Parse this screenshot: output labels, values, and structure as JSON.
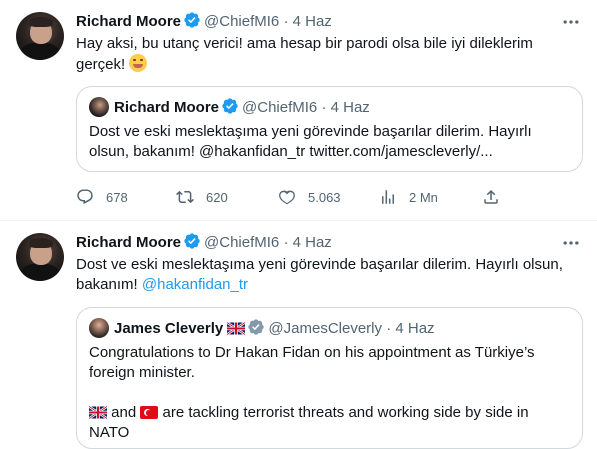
{
  "tweet1": {
    "author_name": "Richard Moore",
    "author_handle": "@ChiefMI6",
    "separator": "·",
    "timestamp": "4 Haz",
    "text": "Hay aksi, bu utanç verici! ama hesap bir parodi olsa bile iyi dileklerim",
    "text_line2": "gerçek!",
    "emoji": "smiling-face-emoji",
    "quoted": {
      "author_name": "Richard Moore",
      "author_handle": "@ChiefMI6",
      "separator": "·",
      "timestamp": "4 Haz",
      "text_line1": "Dost ve eski meslektaşıma yeni görevinde başarılar dilerim.  Hayırlı",
      "text_line2": "olsun, bakanım! @hakanfidan_tr twitter.com/jamescleverly/..."
    },
    "actions": {
      "replies": "678",
      "retweets": "620",
      "likes": "5.063",
      "views": "2 Mn"
    }
  },
  "tweet2": {
    "author_name": "Richard Moore",
    "author_handle": "@ChiefMI6",
    "separator": "·",
    "timestamp": "4 Haz",
    "text_line1": "Dost ve eski meslektaşıma yeni görevinde başarılar dilerim.  Hayırlı olsun,",
    "text_line2_prefix": "bakanım! ",
    "mention": "@hakanfidan_tr",
    "quoted": {
      "author_name": "James Cleverly",
      "author_handle": "@JamesCleverly",
      "separator": "·",
      "timestamp": "4 Haz",
      "text_line1": "Congratulations to Dr Hakan Fidan on his appointment as Türkiye’s",
      "text_line2": "foreign minister.",
      "text_line3_and": " and ",
      "text_line3_rest": " are tackling terrorist threats and working side by side in",
      "text_line4": "NATO"
    }
  },
  "colors": {
    "verified_blue": "#1d9bf0",
    "secondary_text": "#536471",
    "link": "#1d9bf0",
    "border": "#cfd9de"
  }
}
